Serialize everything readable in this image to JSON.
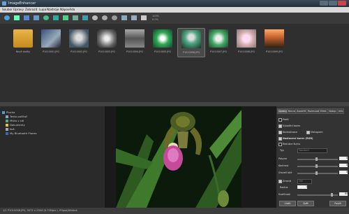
{
  "window": {
    "title": "ImageEnhancer"
  },
  "menu": {
    "items": [
      "Soubor",
      "Úpravy",
      "Zobrazit",
      "Lupa",
      "Nástroje",
      "Nápověda"
    ]
  },
  "toolbar": {
    "zoom_label": "100%",
    "zoom_sub": "0.0%"
  },
  "thumbnails": [
    {
      "name": "Nové složky",
      "kind": "folder"
    },
    {
      "name": "P1010001.JPG",
      "kind": "photo"
    },
    {
      "name": "P1010002.JPG",
      "kind": "photo"
    },
    {
      "name": "P1010003.JPG",
      "kind": "photo"
    },
    {
      "name": "P1010004.JPG",
      "kind": "photo"
    },
    {
      "name": "P1010005.JPG",
      "kind": "photo"
    },
    {
      "name": "P1010006.JPG",
      "kind": "photo",
      "selected": true
    },
    {
      "name": "P1010007.JPG",
      "kind": "photo"
    },
    {
      "name": "P1010008.JPG",
      "kind": "photo"
    },
    {
      "name": "P1010009.JPG",
      "kind": "photo"
    }
  ],
  "tree": {
    "items": [
      "Plocha",
      "Tento počítač",
      "Místa v síti",
      "Dokumenty",
      "Koš",
      "My Bluetooth Places"
    ]
  },
  "panel": {
    "tabs": [
      "Úpravy",
      "Barva",
      "Zaostřit",
      "Rozmazat",
      "Efekt",
      "Vodop",
      "Info"
    ],
    "profile_label": "Profil",
    "auto_colors": "Vyladění barev",
    "normalize": "Normalizace",
    "histogram": "Histogram",
    "adjust_colors": "Nastavení barev (RGB)",
    "vividness": "Redukce šumu",
    "type_label": "Typ",
    "type_value": "Standard",
    "brightness": "Pokyne",
    "contrast": "Kontrast",
    "gamma": "Úroveň bílé",
    "spin_1": "0",
    "spin_2": "0",
    "spin_3": "0",
    "denoise": "Zmenit",
    "denoise_value": "200",
    "radius_label": "Radius",
    "radius_value": "1",
    "quality_label": "Kvalitnost",
    "quality_value": "85",
    "btn_save": "Uložit",
    "btn_undo": "Zpět",
    "btn_apply": "Použít"
  },
  "status": {
    "text": "1/1  P1010006.JPG, 3072 x 2304 (6.75Mpix.), Případ/Atlatná"
  }
}
